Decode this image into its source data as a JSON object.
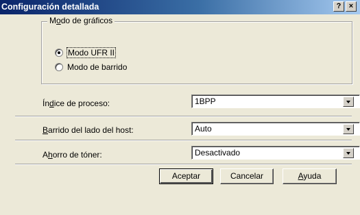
{
  "window": {
    "title": "Configuración detallada",
    "help_button": "?",
    "close_button": "×"
  },
  "graphics_mode": {
    "legend_pre": "M",
    "legend_underline": "o",
    "legend_post": "do de gráficos",
    "options": [
      {
        "label": "Modo UFR II",
        "checked": true
      },
      {
        "label": "Modo de barrido",
        "checked": false
      }
    ]
  },
  "fields": {
    "process_index": {
      "label_pre": "Ín",
      "label_underline": "d",
      "label_post": "ice de proceso:",
      "value": "1BPP"
    },
    "host_scan": {
      "label_pre": "",
      "label_underline": "B",
      "label_post": "arrido del lado del host:",
      "value": "Auto"
    },
    "toner_save": {
      "label_pre": "A",
      "label_underline": "h",
      "label_post": "orro de tóner:",
      "value": "Desactivado"
    }
  },
  "buttons": {
    "accept": "Aceptar",
    "cancel": "Cancelar",
    "help_pre": "",
    "help_underline": "A",
    "help_post": "yuda"
  }
}
